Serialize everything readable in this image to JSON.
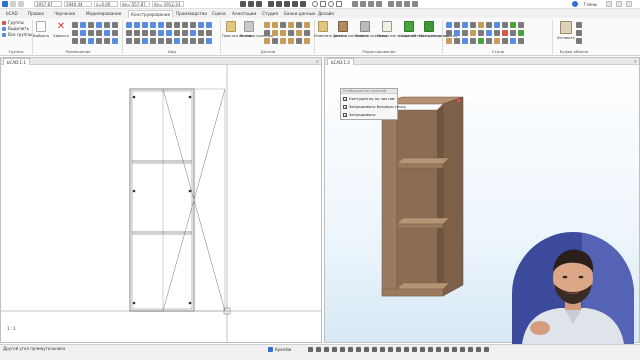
{
  "app": {
    "name": "bCAD"
  },
  "coords": [
    "1957.87",
    "1940.44",
    "z=0.00",
    "dx=-557.87",
    "dy=-1912.33"
  ],
  "window_right": {
    "label": "Гляны"
  },
  "tabs": [
    {
      "label": "bCAD",
      "active": false
    },
    {
      "label": "Правка",
      "active": false
    },
    {
      "label": "Черчение",
      "active": false
    },
    {
      "label": "Моделирование",
      "active": false
    },
    {
      "label": "Конструирование",
      "active": true
    },
    {
      "label": "Производство",
      "active": false
    },
    {
      "label": "Сцена",
      "active": false
    },
    {
      "label": "Аннотации",
      "active": false
    },
    {
      "label": "Студия",
      "active": false
    },
    {
      "label": "Банки данных",
      "active": false
    },
    {
      "label": "Дизайн",
      "active": false
    }
  ],
  "ribbon": {
    "sel_items": [
      "Группы",
      "Выделить",
      "Все группы"
    ],
    "select_label": "Выбрать",
    "delete_label": "Удалить",
    "panel_label": "Простая панель",
    "insert_label": "Вставка крепежа",
    "edit_label": "Изменить деталь",
    "replace_mat_label": "Замена материала",
    "replace_fix_label": "Замена крепежа",
    "cover_label": "Покрытие профилей",
    "open_label": "Скрыть/открыть покрытие",
    "material_label": "Материал покрытия",
    "paste_label": "Вставить",
    "groups": [
      "Группы",
      "Размещение",
      "Вид",
      "Детали",
      "Редактирование",
      "Стили",
      "Буфер обмена"
    ]
  },
  "panes": {
    "left_tab": "bCAD:1:1",
    "right_tab": "bCAD:1:2",
    "left_corner_label": "1 : 1"
  },
  "visibility_panel": {
    "title": "Отображение панелей",
    "options": [
      {
        "label": "Контуренты по частям",
        "checked": true
      },
      {
        "label": "Затрашивать базовую точку",
        "checked": true
      },
      {
        "label": "Затрашивать",
        "checked": true
      }
    ]
  },
  "status": {
    "message": "Другой угол прямоугольника",
    "snap_label": "Крепёж"
  },
  "colors": {
    "accent": "#2f6fd6",
    "wood": "#9b7b5e",
    "wood_dark": "#6f5440",
    "viewport_blue": "#d8e9f6"
  }
}
